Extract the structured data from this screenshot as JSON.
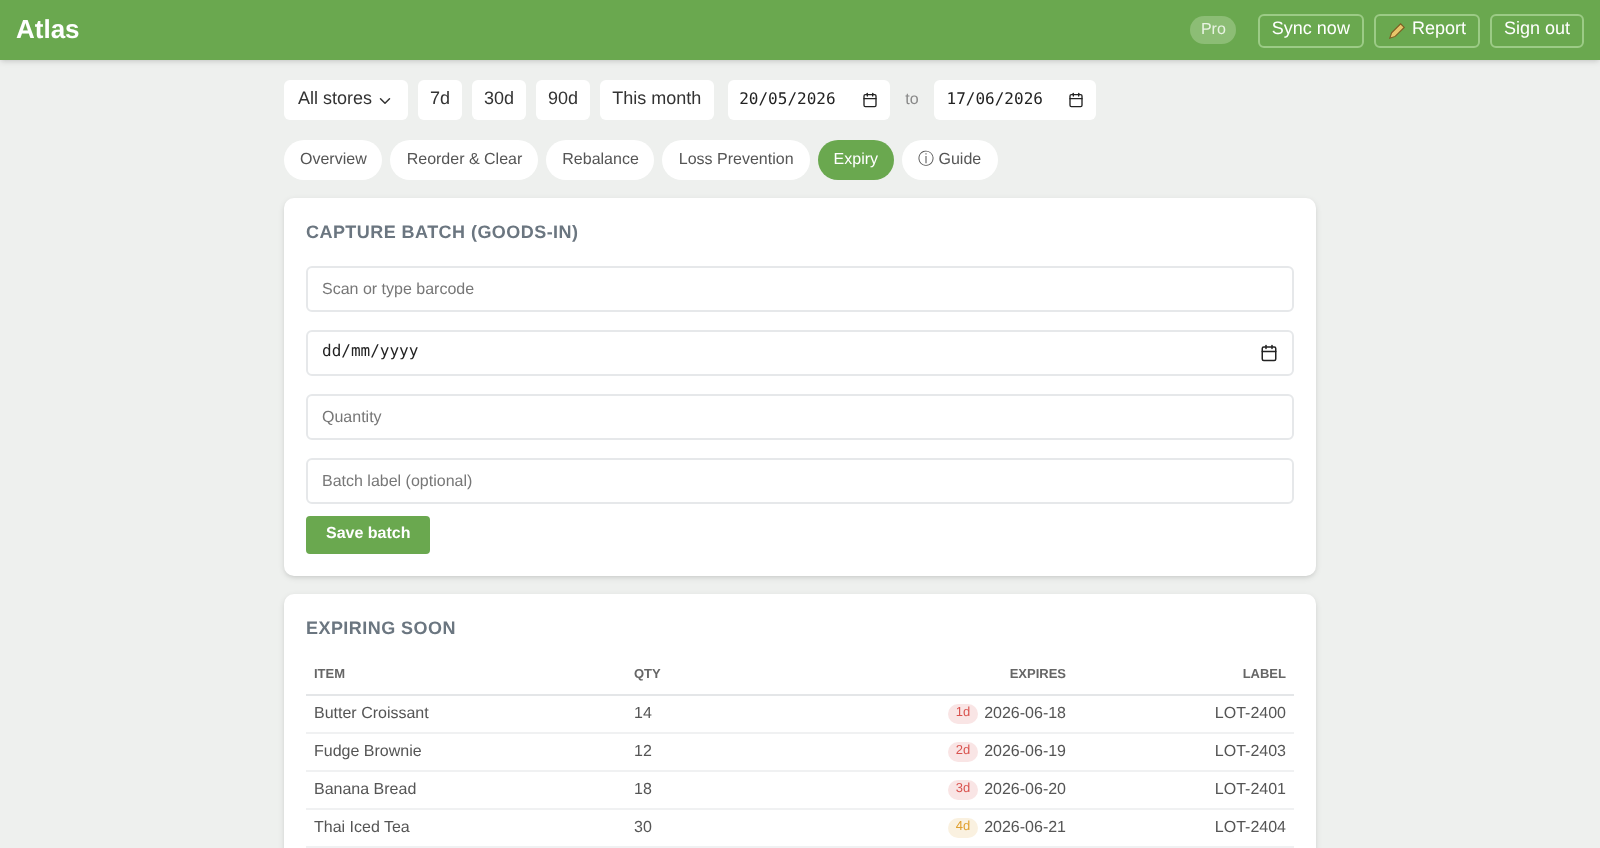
{
  "header": {
    "title": "Atlas",
    "plan_badge": "Pro",
    "buttons": [
      {
        "label": "Sync now",
        "kind": "plain"
      },
      {
        "label": "Report",
        "kind": "icon"
      },
      {
        "label": "Sign out",
        "kind": "plain"
      }
    ]
  },
  "filters": {
    "store": "All stores",
    "ranges": [
      "7d",
      "30d",
      "90d",
      "This month"
    ],
    "from": "20/05/2026",
    "to_label": "to",
    "to": "17/06/2026"
  },
  "tabs": [
    {
      "label": "Overview",
      "selected": false
    },
    {
      "label": "Reorder & Clear",
      "selected": false
    },
    {
      "label": "Rebalance",
      "selected": false
    },
    {
      "label": "Loss Prevention",
      "selected": false
    },
    {
      "label": "Expiry",
      "selected": true
    },
    {
      "label": "ⓘ Guide",
      "selected": false
    }
  ],
  "capture": {
    "title": "CAPTURE BATCH (GOODS-IN)",
    "fields": [
      {
        "kind": "text",
        "placeholder": "Scan or type barcode"
      },
      {
        "kind": "date",
        "placeholder": "dd/mm/yyyy"
      },
      {
        "kind": "text",
        "placeholder": "Quantity"
      },
      {
        "kind": "text",
        "placeholder": "Batch label (optional)"
      }
    ],
    "button": "Save batch"
  },
  "expiring": {
    "title": "EXPIRING SOON",
    "columns": [
      "ITEM",
      "QTY",
      "EXPIRES",
      "LABEL"
    ],
    "rows": [
      {
        "item": "Butter Croissant",
        "qty": "14",
        "badge": "1d",
        "color": "#d9534f",
        "expires": "2026-06-18",
        "label": "LOT-2400"
      },
      {
        "item": "Fudge Brownie",
        "qty": "12",
        "badge": "2d",
        "color": "#d9534f",
        "expires": "2026-06-19",
        "label": "LOT-2403"
      },
      {
        "item": "Banana Bread",
        "qty": "18",
        "badge": "3d",
        "color": "#d9534f",
        "expires": "2026-06-20",
        "label": "LOT-2401"
      },
      {
        "item": "Thai Iced Tea",
        "qty": "30",
        "badge": "4d",
        "color": "#e0a030",
        "expires": "2026-06-21",
        "label": "LOT-2404"
      }
    ]
  }
}
